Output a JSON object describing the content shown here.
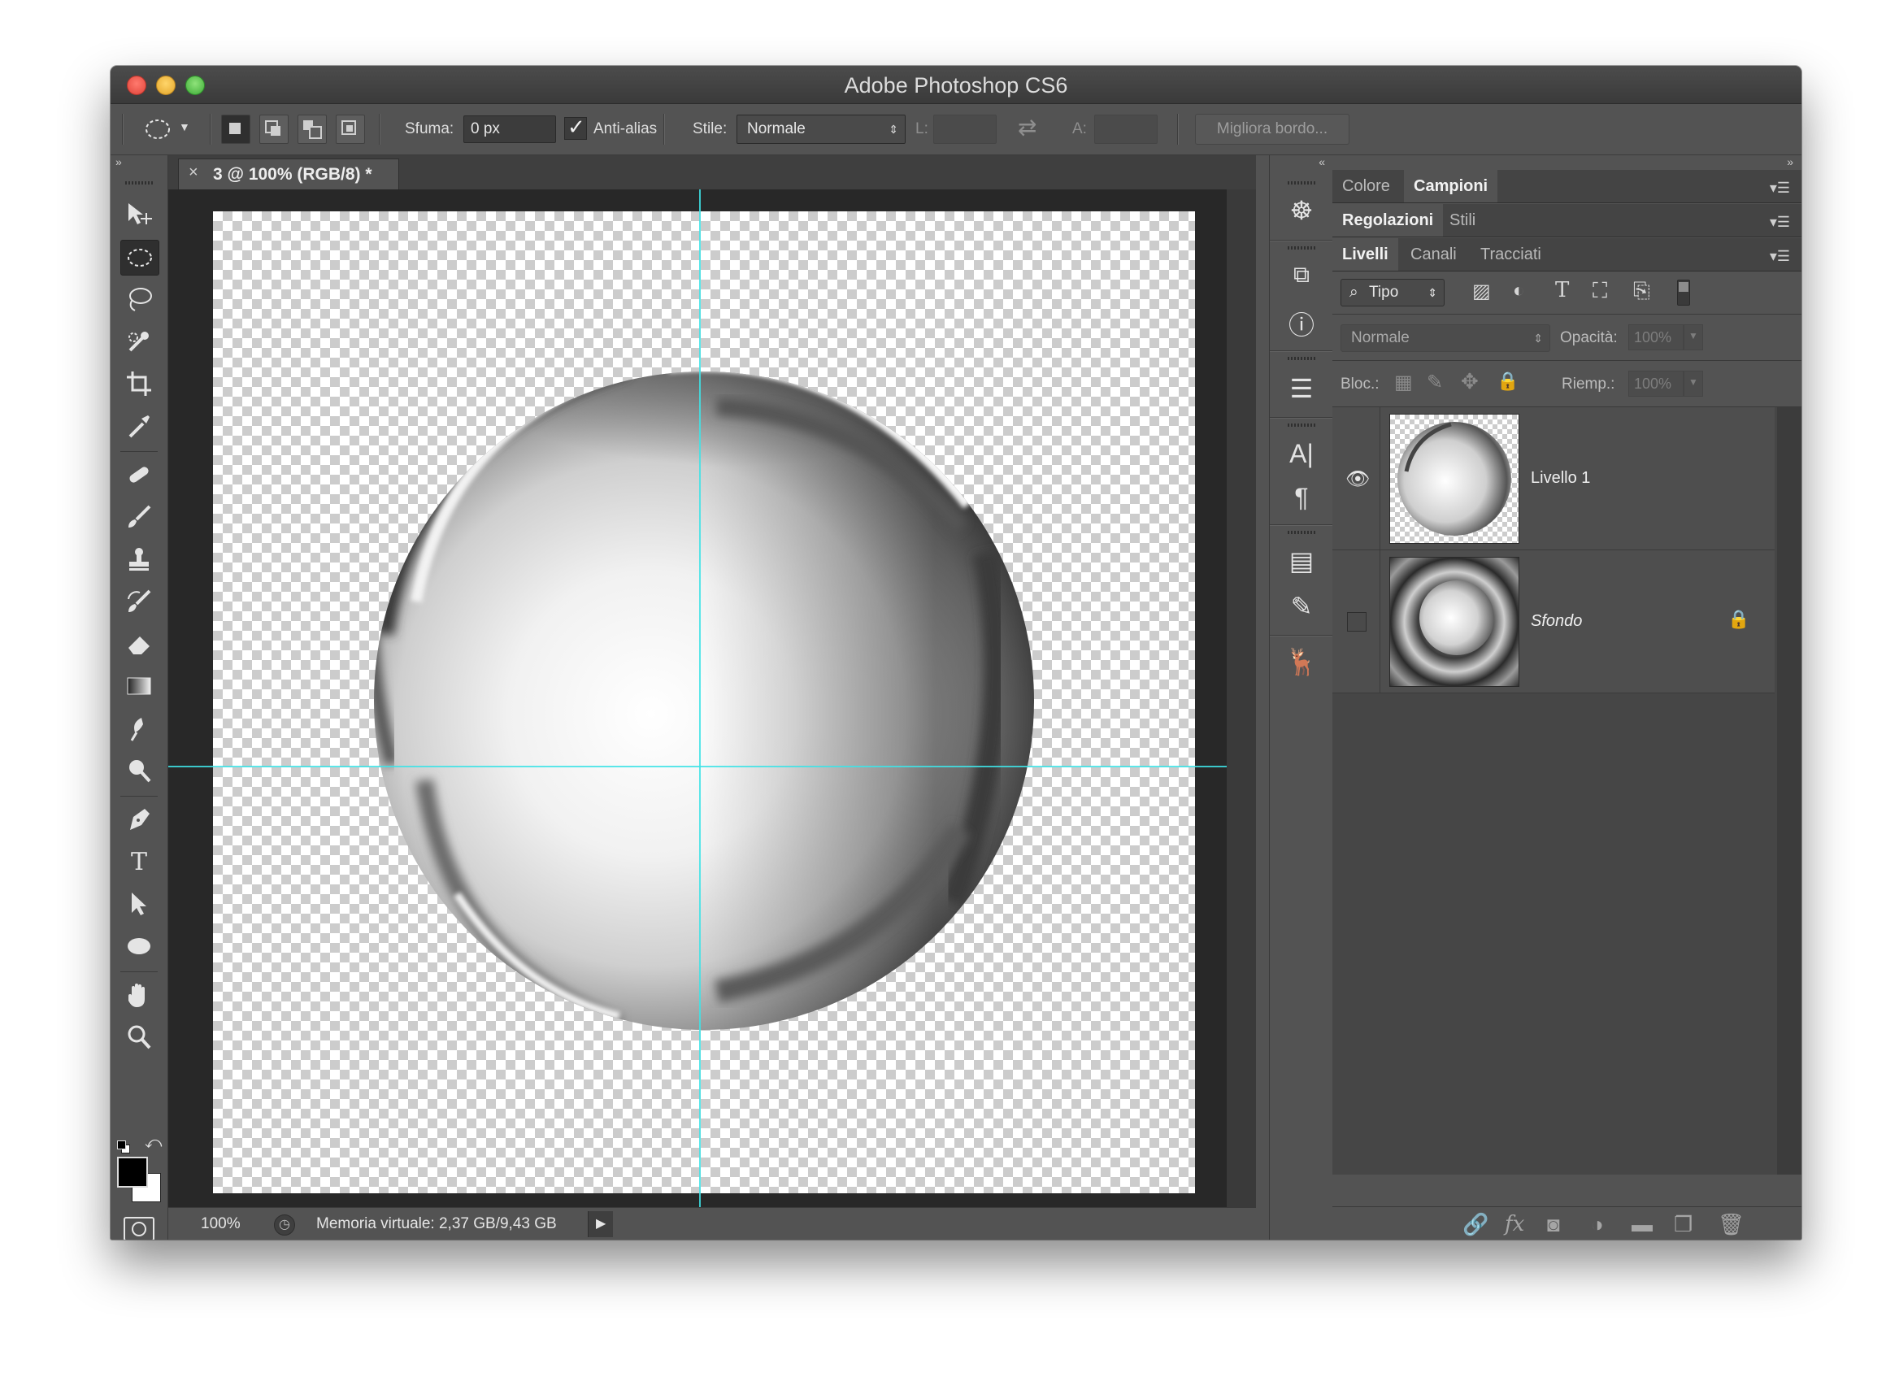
{
  "window": {
    "title": "Adobe Photoshop CS6"
  },
  "options": {
    "feather_label": "Sfuma:",
    "feather_value": "0 px",
    "antialias_label": "Anti-alias",
    "antialias_checked": true,
    "style_label": "Stile:",
    "style_value": "Normale",
    "width_label": "L:",
    "height_label": "A:",
    "refine_edge_label": "Migliora bordo..."
  },
  "document": {
    "tab_title": "3 @ 100% (RGB/8) *",
    "zoom": "100%",
    "status": "Memoria virtuale: 2,37 GB/9,43 GB"
  },
  "panels": {
    "group1_tabs": [
      "Colore",
      "Campioni"
    ],
    "group1_active": "Campioni",
    "group2_tabs": [
      "Regolazioni",
      "Stili"
    ],
    "group2_active": "Regolazioni",
    "group3_tabs": [
      "Livelli",
      "Canali",
      "Tracciati"
    ],
    "group3_active": "Livelli",
    "filter_kind": "Tipo",
    "blend_mode": "Normale",
    "opacity_label": "Opacità:",
    "opacity_value": "100%",
    "lock_label": "Bloc.:",
    "fill_label": "Riemp.:",
    "fill_value": "100%"
  },
  "layers": [
    {
      "name": "Livello 1",
      "visible": true,
      "locked": false
    },
    {
      "name": "Sfondo",
      "visible": false,
      "locked": true
    }
  ],
  "colors": {
    "guide": "#3ee3e6",
    "foreground": "#000000",
    "background": "#ffffff"
  }
}
